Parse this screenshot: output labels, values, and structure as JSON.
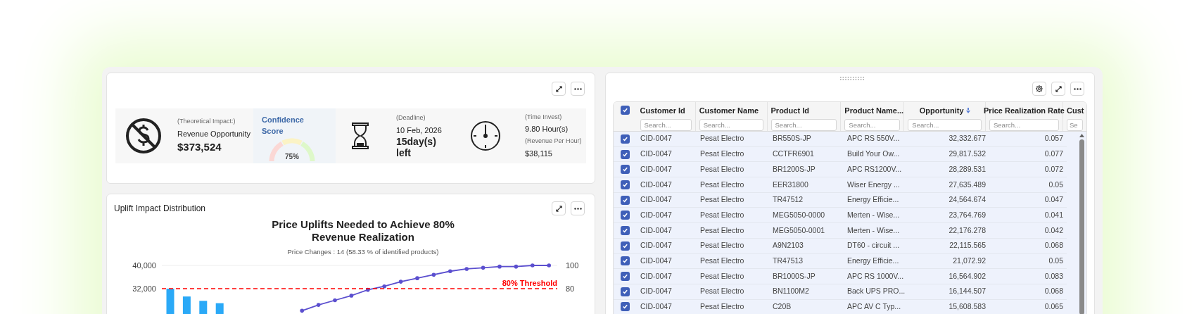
{
  "kpis": {
    "impact": {
      "caption": "(Theoretical Impact:)",
      "label": "Revenue Opportunity",
      "value": "$373,524"
    },
    "confidence": {
      "title": "Confidence Score",
      "reading": "75%"
    },
    "deadline": {
      "caption": "(Deadline)",
      "date": "10 Feb, 2026",
      "remaining": "15day(s) left"
    },
    "time": {
      "caption": "(Time Invest)",
      "hours": "9.80 Hour(s)",
      "caption_2": "(Revenue Per Hour)",
      "value": "$38,115"
    }
  },
  "chart_panel": {
    "title": "Uplift Impact Distribution",
    "subtitle": "Price Changes : 14 (58.33 % of identified products)",
    "chart_data": {
      "type": "bar",
      "title": "Price Uplifts Needed to Achieve 80% Revenue Realization",
      "series": [
        {
          "color": "#2aa9f7",
          "values": [
            32000,
            29300,
            27800,
            27000,
            null,
            null,
            null,
            null,
            null,
            null,
            null,
            null,
            null,
            null,
            null,
            null,
            null,
            null,
            null,
            null,
            null,
            null,
            null,
            null
          ]
        },
        {
          "type": "line",
          "axis": "y2",
          "color": "#5b4fcf",
          "values": [
            null,
            null,
            null,
            null,
            null,
            null,
            null,
            null,
            61,
            66,
            70,
            74,
            79,
            82,
            86,
            89,
            92,
            95,
            97,
            98,
            99,
            99,
            100,
            100
          ]
        }
      ],
      "ylim": [
        0,
        40000
      ],
      "yticks": [
        {
          "value": 40000,
          "label": "40,000"
        },
        {
          "value": 32000,
          "label": "32,000"
        }
      ],
      "y2lim": [
        0,
        100
      ],
      "y2ticks": [
        100,
        80
      ],
      "ref_lines": [
        {
          "axis": "y2",
          "value": 80,
          "label": "80% Threshold",
          "color": "#ff0000"
        }
      ]
    }
  },
  "table": {
    "all_selected": true,
    "columns": [
      {
        "label": "Customer Id",
        "placeholder": "Search...",
        "sorted": false,
        "kind": "text"
      },
      {
        "label": "Customer Name",
        "placeholder": "Search...",
        "sorted": false,
        "kind": "text"
      },
      {
        "label": "Product Id",
        "placeholder": "Search...",
        "sorted": false,
        "kind": "text"
      },
      {
        "label": "Product Name...",
        "placeholder": "Search...",
        "sorted": false,
        "kind": "text"
      },
      {
        "label": "Opportunity",
        "placeholder": "Search...",
        "sorted": true,
        "kind": "number"
      },
      {
        "label": "Price Realization Rate",
        "placeholder": "Search...",
        "sorted": false,
        "kind": "number"
      },
      {
        "label": "Cust",
        "placeholder": "Se",
        "sorted": false,
        "kind": "text"
      }
    ],
    "rows": [
      {
        "selected": true,
        "cells": [
          "CID-0047",
          "Pesat Electro",
          "BR550S-JP",
          "APC RS 550V...",
          "32,332.677",
          "0.057"
        ]
      },
      {
        "selected": true,
        "cells": [
          "CID-0047",
          "Pesat Electro",
          "CCTFR6901",
          "Build Your Ow...",
          "29,817.532",
          "0.077"
        ]
      },
      {
        "selected": true,
        "cells": [
          "CID-0047",
          "Pesat Electro",
          "BR1200S-JP",
          "APC RS1200V...",
          "28,289.531",
          "0.072"
        ]
      },
      {
        "selected": true,
        "cells": [
          "CID-0047",
          "Pesat Electro",
          "EER31800",
          "Wiser Energy ...",
          "27,635.489",
          "0.05"
        ]
      },
      {
        "selected": true,
        "cells": [
          "CID-0047",
          "Pesat Electro",
          "TR47512",
          "Energy Efficie...",
          "24,564.674",
          "0.047"
        ]
      },
      {
        "selected": true,
        "cells": [
          "CID-0047",
          "Pesat Electro",
          "MEG5050-0000",
          "Merten - Wise...",
          "23,764.769",
          "0.041"
        ]
      },
      {
        "selected": true,
        "cells": [
          "CID-0047",
          "Pesat Electro",
          "MEG5050-0001",
          "Merten - Wise...",
          "22,176.278",
          "0.042"
        ]
      },
      {
        "selected": true,
        "cells": [
          "CID-0047",
          "Pesat Electro",
          "A9N2103",
          "DT60 - circuit ...",
          "22,115.565",
          "0.068"
        ]
      },
      {
        "selected": true,
        "cells": [
          "CID-0047",
          "Pesat Electro",
          "TR47513",
          "Energy Efficie...",
          "21,072.92",
          "0.05"
        ]
      },
      {
        "selected": true,
        "cells": [
          "CID-0047",
          "Pesat Electro",
          "BR1000S-JP",
          "APC RS 1000V...",
          "16,564.902",
          "0.083"
        ]
      },
      {
        "selected": true,
        "cells": [
          "CID-0047",
          "Pesat Electro",
          "BN1100M2",
          "Back UPS PRO...",
          "16,144.507",
          "0.068"
        ]
      },
      {
        "selected": true,
        "cells": [
          "CID-0047",
          "Pesat Electro",
          "C20B",
          "APC AV C Typ...",
          "15,608.583",
          "0.065"
        ]
      }
    ]
  }
}
